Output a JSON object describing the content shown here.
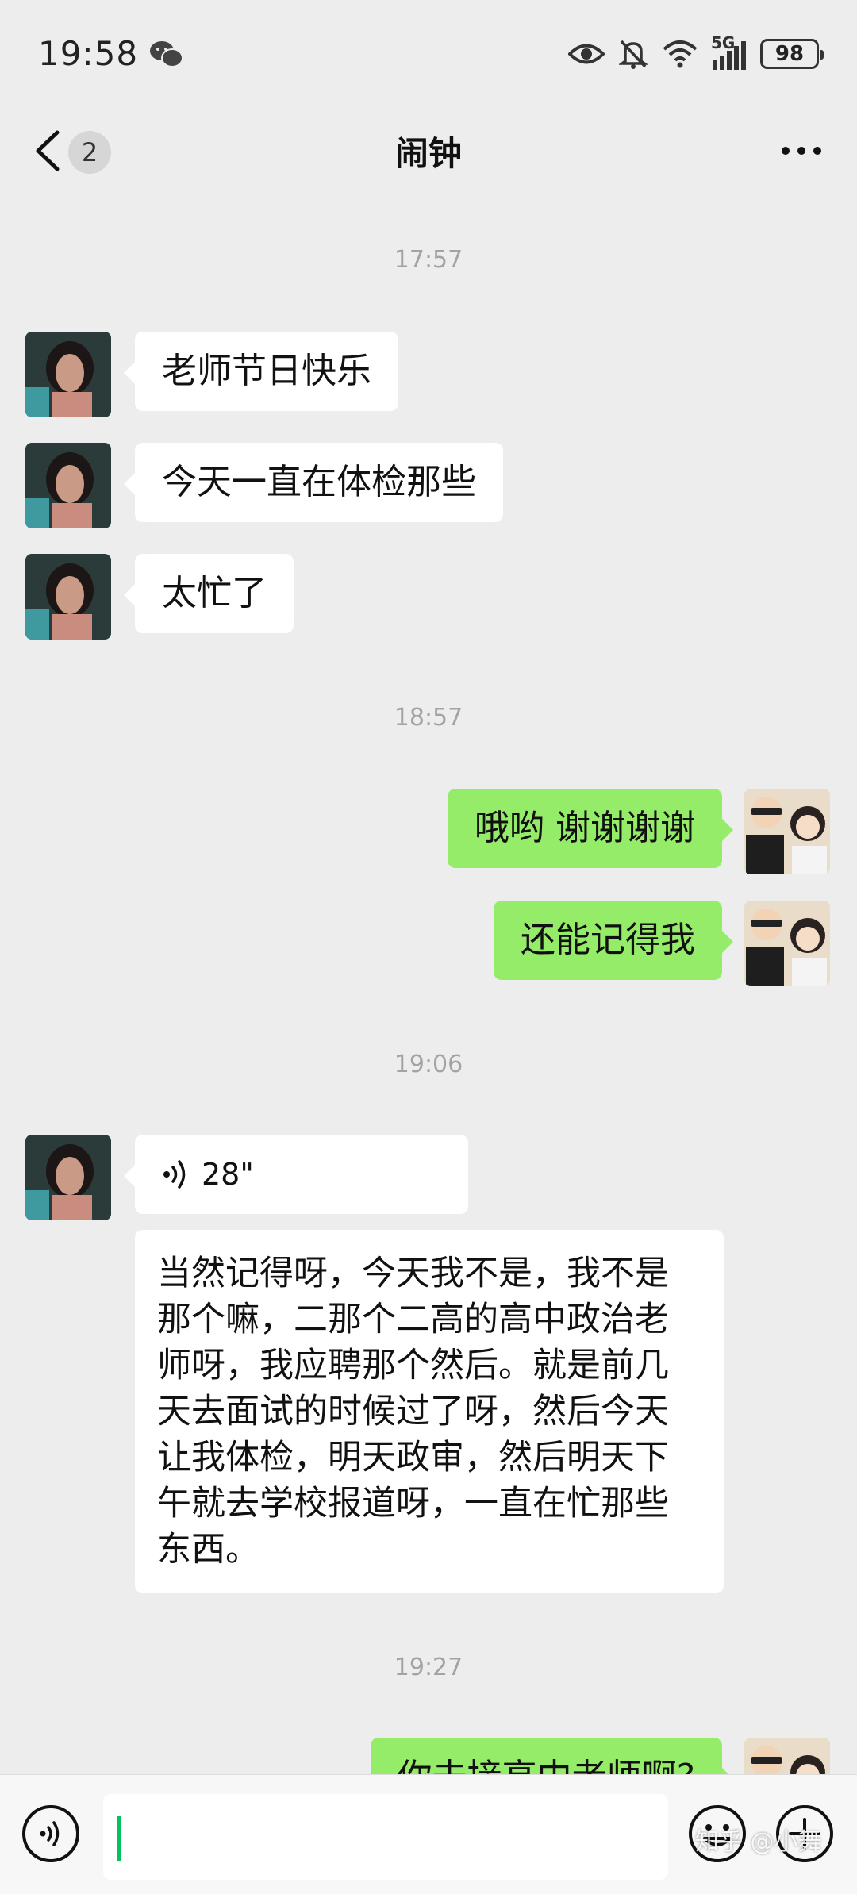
{
  "status_bar": {
    "time": "19:58",
    "network": "5G",
    "battery": "98",
    "icons": [
      "wechat-icon",
      "eye-icon",
      "bell-off-icon",
      "wifi-icon",
      "signal-icon",
      "battery-icon"
    ]
  },
  "nav": {
    "title": "闹钟",
    "unread_count": "2",
    "icons": [
      "back-chevron-icon",
      "more-icon"
    ]
  },
  "messages": {
    "ts1": "17:57",
    "m1": "老师节日快乐",
    "m2": "今天一直在体检那些",
    "m3": "太忙了",
    "ts2": "18:57",
    "m4": "哦哟 谢谢谢谢",
    "m5": "还能记得我",
    "ts3": "19:06",
    "voice_duration": "28\"",
    "transcript": "当然记得呀，今天我不是，我不是那个嘛，二那个二高的高中政治老师呀，我应聘那个然后。就是前几天去面试的时候过了呀，然后今天让我体检，明天政审，然后明天下午就去学校报道呀，一直在忙那些东西。",
    "ts4": "19:27",
    "m6": "你去接高中老师啊?"
  },
  "input_bar": {
    "icons": [
      "voice-toggle-icon",
      "emoji-icon",
      "plus-icon"
    ]
  },
  "watermark": "知乎 @小舞",
  "colors": {
    "background": "#ededed",
    "outgoing_bubble": "#95ec69",
    "incoming_bubble": "#ffffff",
    "cursor": "#07c160"
  }
}
